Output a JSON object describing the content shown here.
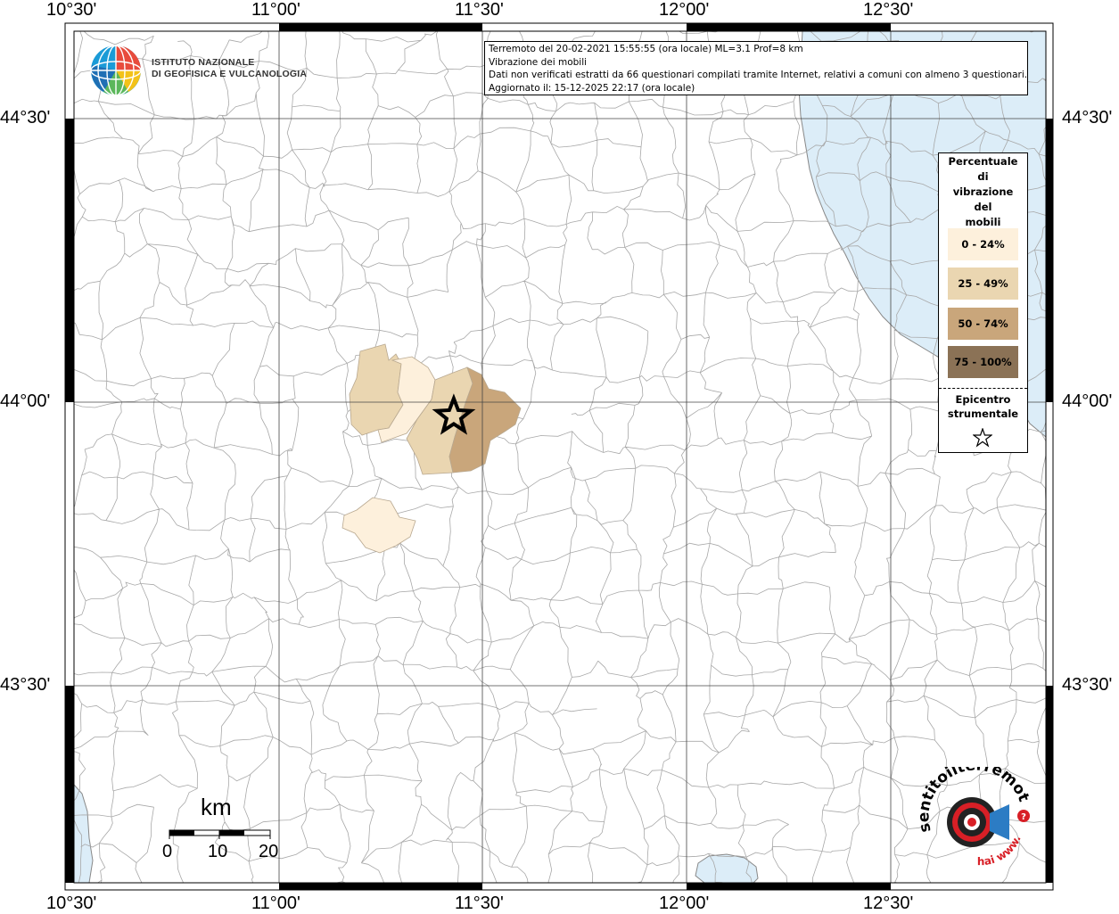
{
  "map": {
    "lon_labels": [
      "10°30'",
      "11°00'",
      "11°30'",
      "12°00'",
      "12°30'"
    ],
    "lat_labels": [
      "44°30'",
      "44°00'",
      "43°30'"
    ],
    "epicenter": {
      "lon": 11.43,
      "lat": 43.975
    },
    "colors": {
      "pct_0_24": "#fdf0dc",
      "pct_25_49": "#ead6b1",
      "pct_50_74": "#c9a67b",
      "pct_75_100": "#8b7256",
      "sea": "#dcedf8",
      "boundary": "#a8a8a8"
    }
  },
  "info": {
    "line1": "Terremoto del 20-02-2021 15:55:55 (ora locale) ML=3.1 Prof=8 km",
    "line2": "Vibrazione dei mobili",
    "line3": "Dati non verificati estratti da 66 questionari compilati tramite Internet, relativi a comuni con almeno 3 questionari.",
    "line4": "Aggiornato il: 15-12-2025 22:17 (ora locale)"
  },
  "legend": {
    "title": [
      "Percentuale",
      "di",
      "vibrazione",
      "del",
      "mobili"
    ],
    "classes": [
      {
        "label": "0 - 24%",
        "color": "#fdf0dc"
      },
      {
        "label": "25 - 49%",
        "color": "#ead6b1"
      },
      {
        "label": "50 - 74%",
        "color": "#c9a67b"
      },
      {
        "label": "75 - 100%",
        "color": "#8b7256"
      }
    ],
    "epicenter_title": [
      "Epicentro",
      "strumentale"
    ],
    "star_icon": "star-icon"
  },
  "logo": {
    "lines": [
      "ISTITUTO NAZIONALE",
      "DI GEOFISICA E VULCANOLOGIA"
    ],
    "icon": "ingv-globe-icon"
  },
  "scale": {
    "unit": "km",
    "ticks": [
      "0",
      "10",
      "20"
    ]
  },
  "hst_logo": {
    "icon": "haisentitoilterremoto-logo-icon"
  }
}
